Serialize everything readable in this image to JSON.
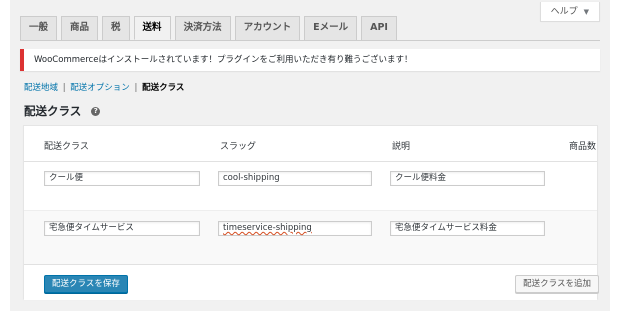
{
  "help": {
    "label": "ヘルプ",
    "chevron": "▼"
  },
  "tabs": [
    {
      "label": "一般"
    },
    {
      "label": "商品"
    },
    {
      "label": "税"
    },
    {
      "label": "送料",
      "active": true
    },
    {
      "label": "決済方法"
    },
    {
      "label": "アカウント"
    },
    {
      "label": "Eメール"
    },
    {
      "label": "API"
    }
  ],
  "notice": {
    "text": "WooCommerceはインストールされています！プラグインをご利用いただき有り難うございます！",
    "border_color": "#dc3232"
  },
  "subnav": {
    "zones": "配送地域",
    "options": "配送オプション",
    "classes": "配送クラス",
    "sep": "|"
  },
  "section": {
    "title": "配送クラス",
    "help_icon": "?"
  },
  "table": {
    "headers": {
      "name": "配送クラス",
      "slug": "スラッグ",
      "description": "説明",
      "count": "商品数"
    },
    "rows": [
      {
        "name": "クール便",
        "slug": "cool-shipping",
        "description": "クール便料金"
      },
      {
        "name": "宅急便タイムサービス",
        "slug": "timeservice-shipping",
        "description": "宅急便タイムサービス料金"
      }
    ]
  },
  "actions": {
    "save": "配送クラスを保存",
    "add": "配送クラスを追加"
  },
  "colors": {
    "primary": "#2a86b5",
    "link": "#0073aa",
    "background": "#f1f1f1"
  }
}
